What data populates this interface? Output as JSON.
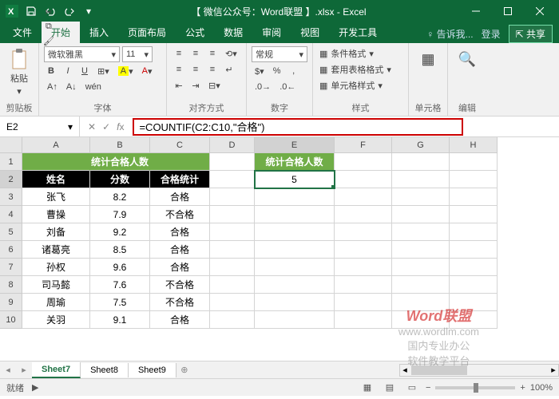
{
  "titlebar": {
    "title": "【 微信公众号：Word联盟 】.xlsx - Excel"
  },
  "tabs": {
    "file": "文件",
    "home": "开始",
    "insert": "插入",
    "layout": "页面布局",
    "formulas": "公式",
    "data": "数据",
    "review": "审阅",
    "view": "视图",
    "dev": "开发工具",
    "tell": "告诉我...",
    "login": "登录",
    "share": "共享"
  },
  "ribbon": {
    "font_name": "微软雅黑",
    "font_size": "11",
    "num_format": "常规",
    "cond_fmt": "条件格式",
    "tbl_fmt": "套用表格格式",
    "cell_style": "单元格样式",
    "g_clip": "剪贴板",
    "g_font": "字体",
    "g_align": "对齐方式",
    "g_num": "数字",
    "g_style": "样式",
    "g_cells": "单元格",
    "g_edit": "编辑",
    "paste": "粘贴"
  },
  "namebox": "E2",
  "formula": "=COUNTIF(C2:C10,\"合格\")",
  "columns": [
    "A",
    "B",
    "C",
    "D",
    "E",
    "F",
    "G",
    "H"
  ],
  "rows": [
    "1",
    "2",
    "3",
    "4",
    "5",
    "6",
    "7",
    "8",
    "9",
    "10"
  ],
  "table": {
    "title": "统计合格人数",
    "h_name": "姓名",
    "h_score": "分数",
    "h_stat": "合格统计",
    "stat_title": "统计合格人数",
    "stat_value": "5",
    "rows": [
      {
        "name": "张飞",
        "score": "8.2",
        "stat": "合格"
      },
      {
        "name": "曹操",
        "score": "7.9",
        "stat": "不合格"
      },
      {
        "name": "刘备",
        "score": "9.2",
        "stat": "合格"
      },
      {
        "name": "诸葛亮",
        "score": "8.5",
        "stat": "合格"
      },
      {
        "name": "孙权",
        "score": "9.6",
        "stat": "合格"
      },
      {
        "name": "司马懿",
        "score": "7.6",
        "stat": "不合格"
      },
      {
        "name": "周瑜",
        "score": "7.5",
        "stat": "不合格"
      },
      {
        "name": "关羽",
        "score": "9.1",
        "stat": "合格"
      }
    ]
  },
  "watermark": {
    "brand": "Word",
    "brand2": "联盟",
    "url": "www.wordlm.com",
    "line2": "国内专业办公",
    "line3": "软件教学平台"
  },
  "sheets": [
    "Sheet7",
    "Sheet8",
    "Sheet9"
  ],
  "status": {
    "ready": "就绪",
    "zoom": "100%"
  }
}
